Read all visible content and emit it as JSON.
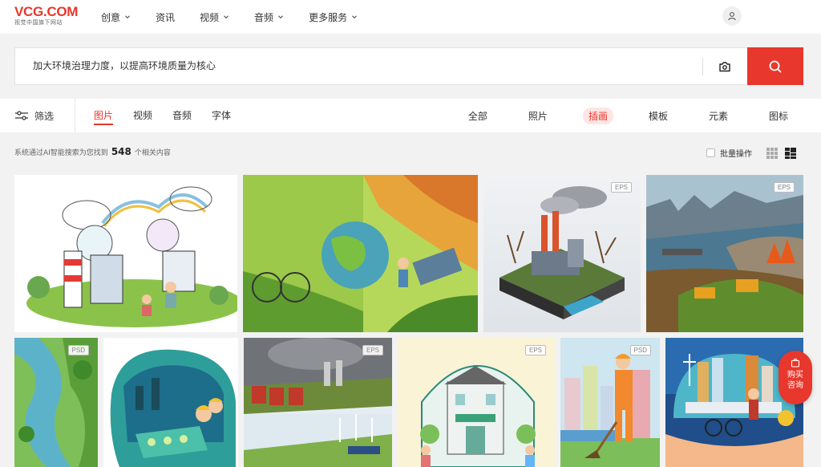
{
  "header": {
    "logo_main": "VCG.COM",
    "logo_sub": "视觉中国旗下网站",
    "nav": [
      {
        "label": "创意",
        "has_dropdown": true
      },
      {
        "label": "资讯",
        "has_dropdown": false
      },
      {
        "label": "视频",
        "has_dropdown": true
      },
      {
        "label": "音频",
        "has_dropdown": true
      },
      {
        "label": "更多服务",
        "has_dropdown": true
      }
    ]
  },
  "search": {
    "query": "加大环境治理力度，以提高环境质量为核心"
  },
  "filterbar": {
    "filter_label": "筛选",
    "type_tabs": [
      "图片",
      "视频",
      "音频",
      "字体"
    ],
    "active_type": "图片",
    "category_tabs": [
      "全部",
      "照片",
      "插画",
      "模板",
      "元素",
      "图标"
    ],
    "active_category": "插画"
  },
  "results": {
    "prefix": "系统通过AI智能搜索为您找到",
    "count": "548",
    "suffix": "个相关内容",
    "batch_label": "批量操作"
  },
  "tiles": [
    {
      "badge": ""
    },
    {
      "badge": ""
    },
    {
      "badge": "EPS"
    },
    {
      "badge": "EPS"
    },
    {
      "badge": "PSD"
    },
    {
      "badge": ""
    },
    {
      "badge": "EPS"
    },
    {
      "badge": "EPS"
    },
    {
      "badge": "PSD"
    },
    {
      "badge": ""
    }
  ],
  "float_button": {
    "label": "购买咨询"
  },
  "colors": {
    "brand": "#e8372c",
    "page_bg": "#f2f2f2"
  }
}
